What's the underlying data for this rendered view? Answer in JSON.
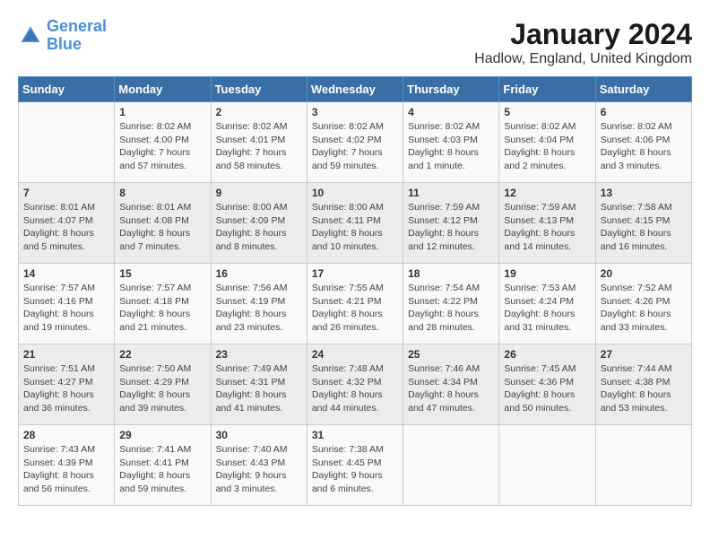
{
  "logo": {
    "line1": "General",
    "line2": "Blue"
  },
  "title": "January 2024",
  "subtitle": "Hadlow, England, United Kingdom",
  "header_color": "#3a6ea5",
  "days_of_week": [
    "Sunday",
    "Monday",
    "Tuesday",
    "Wednesday",
    "Thursday",
    "Friday",
    "Saturday"
  ],
  "weeks": [
    [
      {
        "day": "",
        "info": ""
      },
      {
        "day": "1",
        "info": "Sunrise: 8:02 AM\nSunset: 4:00 PM\nDaylight: 7 hours\nand 57 minutes."
      },
      {
        "day": "2",
        "info": "Sunrise: 8:02 AM\nSunset: 4:01 PM\nDaylight: 7 hours\nand 58 minutes."
      },
      {
        "day": "3",
        "info": "Sunrise: 8:02 AM\nSunset: 4:02 PM\nDaylight: 7 hours\nand 59 minutes."
      },
      {
        "day": "4",
        "info": "Sunrise: 8:02 AM\nSunset: 4:03 PM\nDaylight: 8 hours\nand 1 minute."
      },
      {
        "day": "5",
        "info": "Sunrise: 8:02 AM\nSunset: 4:04 PM\nDaylight: 8 hours\nand 2 minutes."
      },
      {
        "day": "6",
        "info": "Sunrise: 8:02 AM\nSunset: 4:06 PM\nDaylight: 8 hours\nand 3 minutes."
      }
    ],
    [
      {
        "day": "7",
        "info": "Sunrise: 8:01 AM\nSunset: 4:07 PM\nDaylight: 8 hours\nand 5 minutes."
      },
      {
        "day": "8",
        "info": "Sunrise: 8:01 AM\nSunset: 4:08 PM\nDaylight: 8 hours\nand 7 minutes."
      },
      {
        "day": "9",
        "info": "Sunrise: 8:00 AM\nSunset: 4:09 PM\nDaylight: 8 hours\nand 8 minutes."
      },
      {
        "day": "10",
        "info": "Sunrise: 8:00 AM\nSunset: 4:11 PM\nDaylight: 8 hours\nand 10 minutes."
      },
      {
        "day": "11",
        "info": "Sunrise: 7:59 AM\nSunset: 4:12 PM\nDaylight: 8 hours\nand 12 minutes."
      },
      {
        "day": "12",
        "info": "Sunrise: 7:59 AM\nSunset: 4:13 PM\nDaylight: 8 hours\nand 14 minutes."
      },
      {
        "day": "13",
        "info": "Sunrise: 7:58 AM\nSunset: 4:15 PM\nDaylight: 8 hours\nand 16 minutes."
      }
    ],
    [
      {
        "day": "14",
        "info": "Sunrise: 7:57 AM\nSunset: 4:16 PM\nDaylight: 8 hours\nand 19 minutes."
      },
      {
        "day": "15",
        "info": "Sunrise: 7:57 AM\nSunset: 4:18 PM\nDaylight: 8 hours\nand 21 minutes."
      },
      {
        "day": "16",
        "info": "Sunrise: 7:56 AM\nSunset: 4:19 PM\nDaylight: 8 hours\nand 23 minutes."
      },
      {
        "day": "17",
        "info": "Sunrise: 7:55 AM\nSunset: 4:21 PM\nDaylight: 8 hours\nand 26 minutes."
      },
      {
        "day": "18",
        "info": "Sunrise: 7:54 AM\nSunset: 4:22 PM\nDaylight: 8 hours\nand 28 minutes."
      },
      {
        "day": "19",
        "info": "Sunrise: 7:53 AM\nSunset: 4:24 PM\nDaylight: 8 hours\nand 31 minutes."
      },
      {
        "day": "20",
        "info": "Sunrise: 7:52 AM\nSunset: 4:26 PM\nDaylight: 8 hours\nand 33 minutes."
      }
    ],
    [
      {
        "day": "21",
        "info": "Sunrise: 7:51 AM\nSunset: 4:27 PM\nDaylight: 8 hours\nand 36 minutes."
      },
      {
        "day": "22",
        "info": "Sunrise: 7:50 AM\nSunset: 4:29 PM\nDaylight: 8 hours\nand 39 minutes."
      },
      {
        "day": "23",
        "info": "Sunrise: 7:49 AM\nSunset: 4:31 PM\nDaylight: 8 hours\nand 41 minutes."
      },
      {
        "day": "24",
        "info": "Sunrise: 7:48 AM\nSunset: 4:32 PM\nDaylight: 8 hours\nand 44 minutes."
      },
      {
        "day": "25",
        "info": "Sunrise: 7:46 AM\nSunset: 4:34 PM\nDaylight: 8 hours\nand 47 minutes."
      },
      {
        "day": "26",
        "info": "Sunrise: 7:45 AM\nSunset: 4:36 PM\nDaylight: 8 hours\nand 50 minutes."
      },
      {
        "day": "27",
        "info": "Sunrise: 7:44 AM\nSunset: 4:38 PM\nDaylight: 8 hours\nand 53 minutes."
      }
    ],
    [
      {
        "day": "28",
        "info": "Sunrise: 7:43 AM\nSunset: 4:39 PM\nDaylight: 8 hours\nand 56 minutes."
      },
      {
        "day": "29",
        "info": "Sunrise: 7:41 AM\nSunset: 4:41 PM\nDaylight: 8 hours\nand 59 minutes."
      },
      {
        "day": "30",
        "info": "Sunrise: 7:40 AM\nSunset: 4:43 PM\nDaylight: 9 hours\nand 3 minutes."
      },
      {
        "day": "31",
        "info": "Sunrise: 7:38 AM\nSunset: 4:45 PM\nDaylight: 9 hours\nand 6 minutes."
      },
      {
        "day": "",
        "info": ""
      },
      {
        "day": "",
        "info": ""
      },
      {
        "day": "",
        "info": ""
      }
    ]
  ]
}
